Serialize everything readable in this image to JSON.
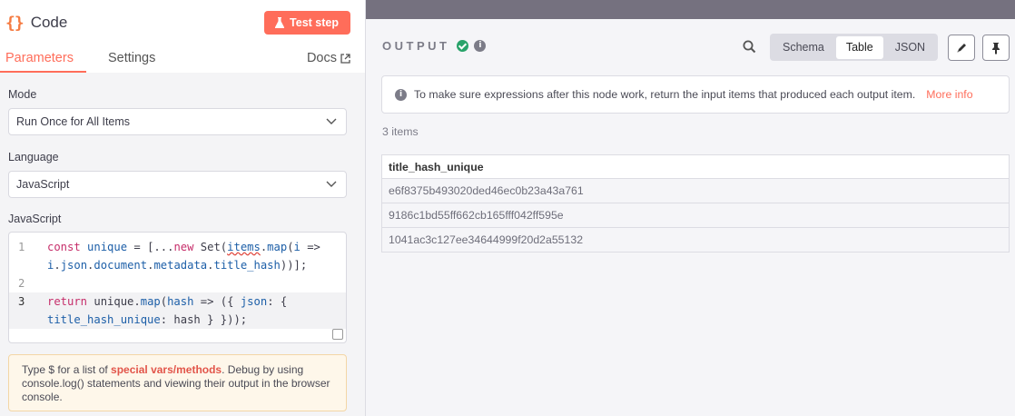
{
  "node": {
    "icon_text": "{}",
    "title": "Code",
    "test_button": "Test step"
  },
  "tabs": {
    "parameters": "Parameters",
    "settings": "Settings",
    "docs": "Docs"
  },
  "params": {
    "mode_label": "Mode",
    "mode_value": "Run Once for All Items",
    "language_label": "Language",
    "language_value": "JavaScript",
    "code_label": "JavaScript",
    "line_numbers": [
      "1",
      "2",
      "3"
    ]
  },
  "hint": {
    "prefix": "Type $ for a list of ",
    "link": "special vars/methods",
    "suffix": ". Debug by using console.log() statements and viewing their output in the browser console."
  },
  "output": {
    "title": "OUTPUT",
    "views": [
      "Schema",
      "Table",
      "JSON"
    ],
    "selected_view": "Table",
    "notice_text": "To make sure expressions after this node work, return the input items that produced each output item.",
    "notice_link": "More info",
    "item_count": "3 items",
    "table": {
      "column": "title_hash_unique",
      "rows": [
        "e6f8375b493020ded46ec0b23a43a761",
        "9186c1bd55ff662cb165fff042ff595e",
        "1041ac3c127ee34644999f20d2a55132"
      ]
    }
  },
  "colors": {
    "accent": "#ff6d5a",
    "success": "#29a36a",
    "topbar": "#75717f"
  }
}
